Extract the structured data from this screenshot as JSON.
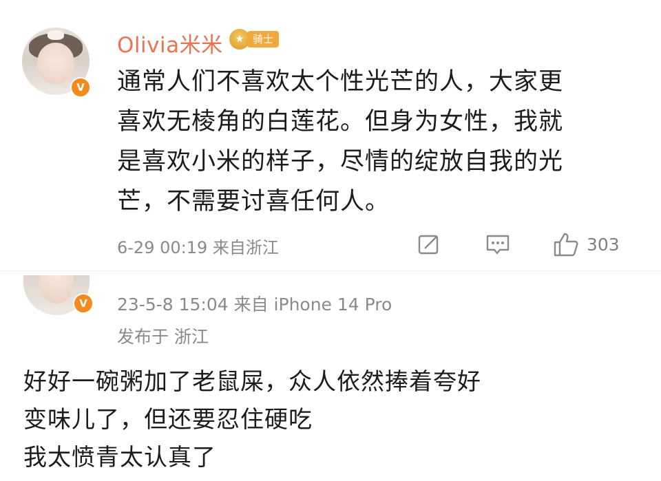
{
  "post": {
    "username": "Olivia米米",
    "medal_label": "骑士",
    "verified_mark": "V",
    "lines": [
      "通常人们不喜欢太个性光芒的人，大家更",
      "喜欢无棱角的白莲花。但身为女性，我就",
      "是喜欢小米的样子，尽情的绽放自我的光",
      "芒，不需要讨喜任何人。"
    ],
    "meta": "6-29 00:19  来自浙江",
    "likes": "303",
    "icons": [
      "share-icon",
      "comment-icon",
      "like-icon"
    ]
  },
  "reply": {
    "verified_mark": "V",
    "meta_line1": "23-5-8 15:04  来自 iPhone 14 Pro",
    "meta_line2": "发布于 浙江",
    "lines": [
      "好好一碗粥加了老鼠屎，众人依然捧着夸好",
      "变味儿了，但还要忍住硬吃",
      "我太愤青太认真了"
    ]
  },
  "colors": {
    "username": "#eb7350",
    "verified_badge": "#f28a1c",
    "meta_text": "#8a8a8a",
    "body_text": "#1c1c1c"
  }
}
